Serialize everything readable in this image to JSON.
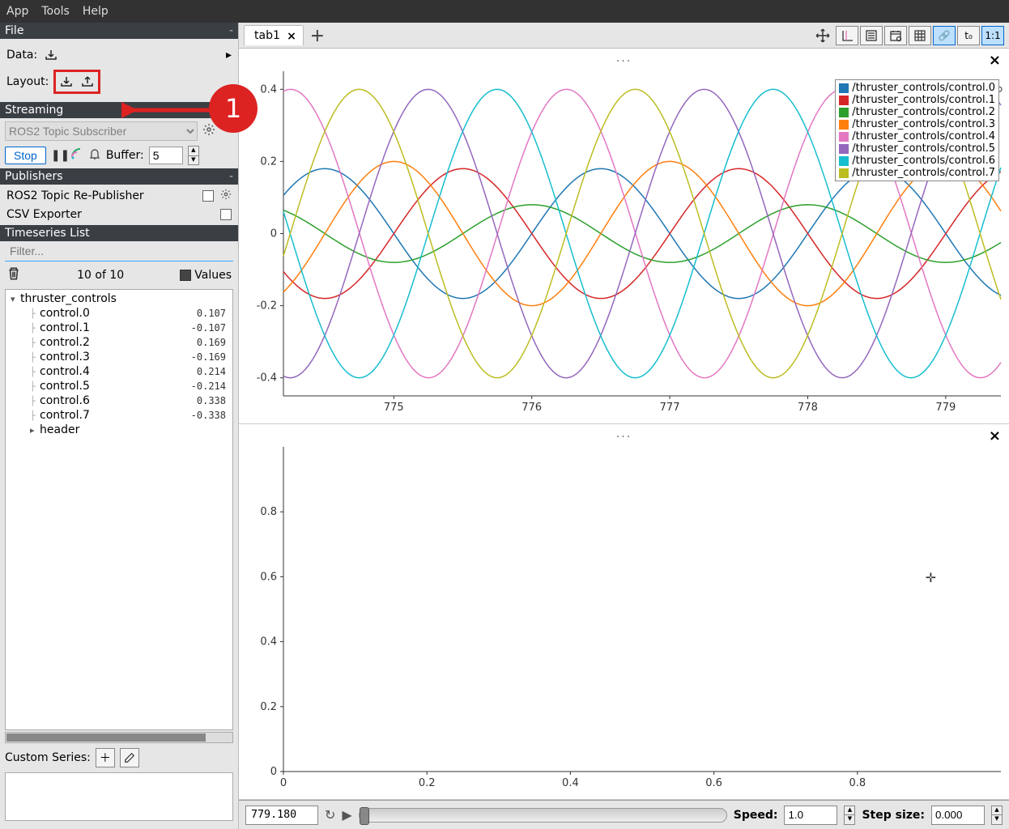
{
  "menubar": {
    "items": [
      "App",
      "Tools",
      "Help"
    ]
  },
  "sidebar": {
    "file": {
      "header": "File",
      "data_label": "Data:",
      "layout_label": "Layout:"
    },
    "streaming": {
      "header": "Streaming",
      "combo_value": "ROS2 Topic Subscriber",
      "stop_label": "Stop",
      "buffer_label": "Buffer:",
      "buffer_value": "5"
    },
    "publishers": {
      "header": "Publishers",
      "items": [
        {
          "label": "ROS2 Topic Re-Publisher",
          "has_gear": true
        },
        {
          "label": "CSV Exporter",
          "has_gear": false
        }
      ]
    },
    "timeseries": {
      "header": "Timeseries List",
      "filter_placeholder": "Filter...",
      "count_text": "10 of 10",
      "values_label": "Values",
      "root": "thruster_controls",
      "controls": [
        {
          "name": "control.0",
          "value": "0.107"
        },
        {
          "name": "control.1",
          "value": "-0.107"
        },
        {
          "name": "control.2",
          "value": "0.169"
        },
        {
          "name": "control.3",
          "value": "-0.169"
        },
        {
          "name": "control.4",
          "value": "0.214"
        },
        {
          "name": "control.5",
          "value": "-0.214"
        },
        {
          "name": "control.6",
          "value": "0.338"
        },
        {
          "name": "control.7",
          "value": "-0.338"
        }
      ],
      "extra_item": "header"
    },
    "custom_series": {
      "label": "Custom Series:"
    }
  },
  "annotation": {
    "number": "1"
  },
  "tabbar": {
    "tab_label": "tab1"
  },
  "toolbar": {
    "link_label": "🔗",
    "t0_label": "t₀",
    "ratio_label": "1:1"
  },
  "plot1": {
    "title": "...",
    "legend": [
      {
        "color": "#1f77b4",
        "label": "/thruster_controls/control.0"
      },
      {
        "color": "#d62728",
        "label": "/thruster_controls/control.1"
      },
      {
        "color": "#2ca02c",
        "label": "/thruster_controls/control.2"
      },
      {
        "color": "#ff7f0e",
        "label": "/thruster_controls/control.3"
      },
      {
        "color": "#e377c2",
        "label": "/thruster_controls/control.4"
      },
      {
        "color": "#9467bd",
        "label": "/thruster_controls/control.5"
      },
      {
        "color": "#17becf",
        "label": "/thruster_controls/control.6"
      },
      {
        "color": "#bcbd22",
        "label": "/thruster_controls/control.7"
      }
    ]
  },
  "plot2": {
    "title": "..."
  },
  "bottombar": {
    "time_value": "779.180",
    "speed_label": "Speed:",
    "speed_value": "1.0",
    "step_label": "Step size:",
    "step_value": "0.000"
  },
  "chart_data": [
    {
      "type": "line",
      "x_range": [
        774.2,
        779.4
      ],
      "y_range": [
        -0.45,
        0.45
      ],
      "x_ticks": [
        775,
        776,
        777,
        778,
        779
      ],
      "y_ticks": [
        -0.4,
        -0.2,
        0,
        0.2,
        0.4
      ],
      "series": [
        {
          "name": "/thruster_controls/control.0",
          "color": "#1f77b4",
          "amplitude": 0.18,
          "phase": 0.0,
          "period": 2.0
        },
        {
          "name": "/thruster_controls/control.1",
          "color": "#d62728",
          "amplitude": 0.18,
          "phase": 3.14,
          "period": 2.0
        },
        {
          "name": "/thruster_controls/control.2",
          "color": "#2ca02c",
          "amplitude": 0.08,
          "phase": 1.57,
          "period": 2.0
        },
        {
          "name": "/thruster_controls/control.3",
          "color": "#ff7f0e",
          "amplitude": 0.2,
          "phase": 4.71,
          "period": 2.0
        },
        {
          "name": "/thruster_controls/control.4",
          "color": "#e377c2",
          "amplitude": 0.4,
          "phase": 0.78,
          "period": 2.0
        },
        {
          "name": "/thruster_controls/control.5",
          "color": "#9467bd",
          "amplitude": 0.4,
          "phase": 3.93,
          "period": 2.0
        },
        {
          "name": "/thruster_controls/control.6",
          "color": "#17becf",
          "amplitude": 0.4,
          "phase": 2.36,
          "period": 2.0
        },
        {
          "name": "/thruster_controls/control.7",
          "color": "#bcbd22",
          "amplitude": 0.4,
          "phase": 5.5,
          "period": 2.0
        }
      ]
    },
    {
      "type": "line",
      "x_range": [
        0,
        1.0
      ],
      "y_range": [
        0,
        1.0
      ],
      "x_ticks": [
        0,
        0.2,
        0.4,
        0.6,
        0.8
      ],
      "y_ticks": [
        0,
        0.2,
        0.4,
        0.6,
        0.8
      ],
      "series": []
    }
  ]
}
